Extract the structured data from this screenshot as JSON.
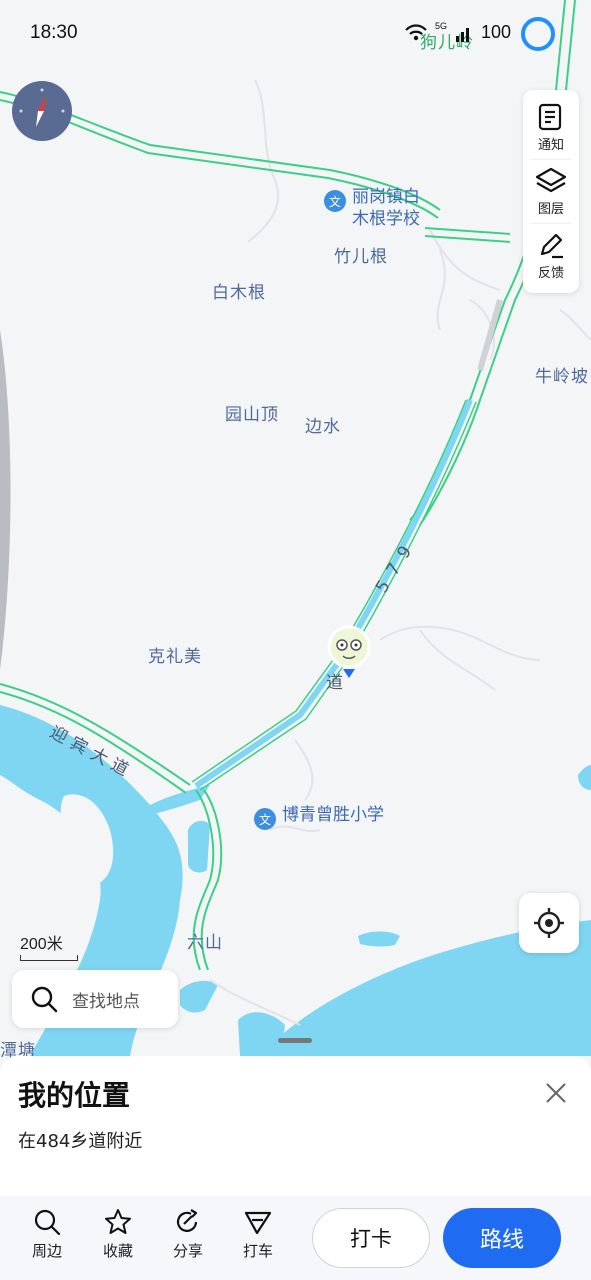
{
  "status_bar": {
    "time": "18:30",
    "network": "5G",
    "battery": "100"
  },
  "map": {
    "places": {
      "zhuergen": "竹儿根",
      "baimugen": "白木根",
      "yuanshanding": "园山顶",
      "bianshui": "边水",
      "niulingpo": "牛岭坡",
      "kelimei": "克礼美",
      "liushan": "六山",
      "tantang": "潭塘",
      "gouerling": "狗儿岭"
    },
    "pois": {
      "school1": "丽岗镇白\n木根学校",
      "school2": "博青曾胜小学"
    },
    "roads": {
      "yingbin": "迎宾大道",
      "road_num": "5 7 9",
      "road_dao": "道"
    },
    "marker_icon": "avatar-marker-icon"
  },
  "toolbar": {
    "notify": "通知",
    "layers": "图层",
    "feedback": "反馈"
  },
  "scale": "200米",
  "search": {
    "placeholder": "查找地点"
  },
  "panel": {
    "title": "我的位置",
    "subtitle": "在484乡道附近"
  },
  "actions": {
    "nearby": "周边",
    "favorite": "收藏",
    "share": "分享",
    "taxi": "打车",
    "checkin": "打卡",
    "route": "路线"
  },
  "colors": {
    "water": "#7fd6f2",
    "road_green": "#3ccf86",
    "route_blue": "#1f6cf3",
    "poi_blue": "#3c8fe0"
  }
}
